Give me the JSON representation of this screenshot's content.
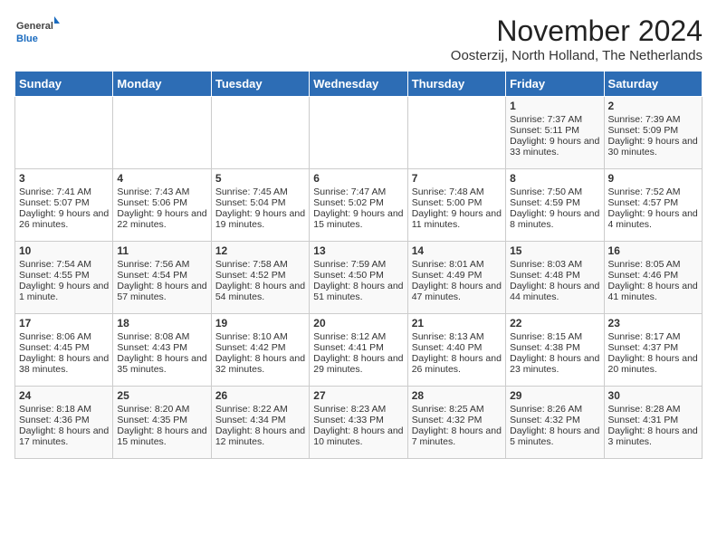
{
  "logo": {
    "general": "General",
    "blue": "Blue"
  },
  "title": "November 2024",
  "location": "Oosterzij, North Holland, The Netherlands",
  "headers": [
    "Sunday",
    "Monday",
    "Tuesday",
    "Wednesday",
    "Thursday",
    "Friday",
    "Saturday"
  ],
  "weeks": [
    [
      {
        "day": "",
        "info": ""
      },
      {
        "day": "",
        "info": ""
      },
      {
        "day": "",
        "info": ""
      },
      {
        "day": "",
        "info": ""
      },
      {
        "day": "",
        "info": ""
      },
      {
        "day": "1",
        "info": "Sunrise: 7:37 AM\nSunset: 5:11 PM\nDaylight: 9 hours and 33 minutes."
      },
      {
        "day": "2",
        "info": "Sunrise: 7:39 AM\nSunset: 5:09 PM\nDaylight: 9 hours and 30 minutes."
      }
    ],
    [
      {
        "day": "3",
        "info": "Sunrise: 7:41 AM\nSunset: 5:07 PM\nDaylight: 9 hours and 26 minutes."
      },
      {
        "day": "4",
        "info": "Sunrise: 7:43 AM\nSunset: 5:06 PM\nDaylight: 9 hours and 22 minutes."
      },
      {
        "day": "5",
        "info": "Sunrise: 7:45 AM\nSunset: 5:04 PM\nDaylight: 9 hours and 19 minutes."
      },
      {
        "day": "6",
        "info": "Sunrise: 7:47 AM\nSunset: 5:02 PM\nDaylight: 9 hours and 15 minutes."
      },
      {
        "day": "7",
        "info": "Sunrise: 7:48 AM\nSunset: 5:00 PM\nDaylight: 9 hours and 11 minutes."
      },
      {
        "day": "8",
        "info": "Sunrise: 7:50 AM\nSunset: 4:59 PM\nDaylight: 9 hours and 8 minutes."
      },
      {
        "day": "9",
        "info": "Sunrise: 7:52 AM\nSunset: 4:57 PM\nDaylight: 9 hours and 4 minutes."
      }
    ],
    [
      {
        "day": "10",
        "info": "Sunrise: 7:54 AM\nSunset: 4:55 PM\nDaylight: 9 hours and 1 minute."
      },
      {
        "day": "11",
        "info": "Sunrise: 7:56 AM\nSunset: 4:54 PM\nDaylight: 8 hours and 57 minutes."
      },
      {
        "day": "12",
        "info": "Sunrise: 7:58 AM\nSunset: 4:52 PM\nDaylight: 8 hours and 54 minutes."
      },
      {
        "day": "13",
        "info": "Sunrise: 7:59 AM\nSunset: 4:50 PM\nDaylight: 8 hours and 51 minutes."
      },
      {
        "day": "14",
        "info": "Sunrise: 8:01 AM\nSunset: 4:49 PM\nDaylight: 8 hours and 47 minutes."
      },
      {
        "day": "15",
        "info": "Sunrise: 8:03 AM\nSunset: 4:48 PM\nDaylight: 8 hours and 44 minutes."
      },
      {
        "day": "16",
        "info": "Sunrise: 8:05 AM\nSunset: 4:46 PM\nDaylight: 8 hours and 41 minutes."
      }
    ],
    [
      {
        "day": "17",
        "info": "Sunrise: 8:06 AM\nSunset: 4:45 PM\nDaylight: 8 hours and 38 minutes."
      },
      {
        "day": "18",
        "info": "Sunrise: 8:08 AM\nSunset: 4:43 PM\nDaylight: 8 hours and 35 minutes."
      },
      {
        "day": "19",
        "info": "Sunrise: 8:10 AM\nSunset: 4:42 PM\nDaylight: 8 hours and 32 minutes."
      },
      {
        "day": "20",
        "info": "Sunrise: 8:12 AM\nSunset: 4:41 PM\nDaylight: 8 hours and 29 minutes."
      },
      {
        "day": "21",
        "info": "Sunrise: 8:13 AM\nSunset: 4:40 PM\nDaylight: 8 hours and 26 minutes."
      },
      {
        "day": "22",
        "info": "Sunrise: 8:15 AM\nSunset: 4:38 PM\nDaylight: 8 hours and 23 minutes."
      },
      {
        "day": "23",
        "info": "Sunrise: 8:17 AM\nSunset: 4:37 PM\nDaylight: 8 hours and 20 minutes."
      }
    ],
    [
      {
        "day": "24",
        "info": "Sunrise: 8:18 AM\nSunset: 4:36 PM\nDaylight: 8 hours and 17 minutes."
      },
      {
        "day": "25",
        "info": "Sunrise: 8:20 AM\nSunset: 4:35 PM\nDaylight: 8 hours and 15 minutes."
      },
      {
        "day": "26",
        "info": "Sunrise: 8:22 AM\nSunset: 4:34 PM\nDaylight: 8 hours and 12 minutes."
      },
      {
        "day": "27",
        "info": "Sunrise: 8:23 AM\nSunset: 4:33 PM\nDaylight: 8 hours and 10 minutes."
      },
      {
        "day": "28",
        "info": "Sunrise: 8:25 AM\nSunset: 4:32 PM\nDaylight: 8 hours and 7 minutes."
      },
      {
        "day": "29",
        "info": "Sunrise: 8:26 AM\nSunset: 4:32 PM\nDaylight: 8 hours and 5 minutes."
      },
      {
        "day": "30",
        "info": "Sunrise: 8:28 AM\nSunset: 4:31 PM\nDaylight: 8 hours and 3 minutes."
      }
    ]
  ]
}
